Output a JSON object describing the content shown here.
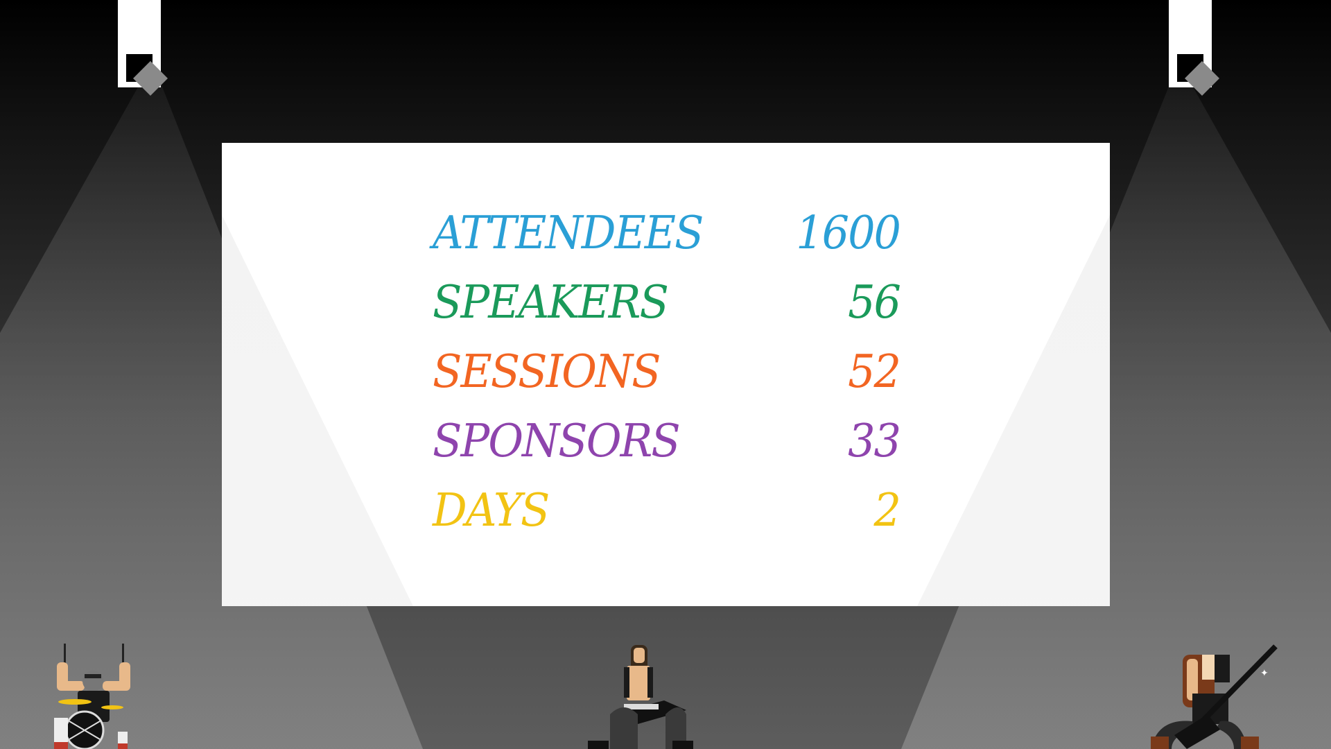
{
  "stats": [
    {
      "label": "ATTENDEES",
      "value": "1600",
      "color": "#2a9fd6"
    },
    {
      "label": "SPEAKERS",
      "value": "56",
      "color": "#1a9a5a"
    },
    {
      "label": "SESSIONS",
      "value": "52",
      "color": "#f26522"
    },
    {
      "label": "SPONSORS",
      "value": "33",
      "color": "#8e44ad"
    },
    {
      "label": "DAYS",
      "value": "2",
      "color": "#f2c313"
    }
  ],
  "icons": {
    "left_spotlight": "spotlight-icon",
    "right_spotlight": "spotlight-icon",
    "drummer": "drummer-icon",
    "singer": "singer-guitarist-icon",
    "bassist": "bassist-icon"
  },
  "colors": {
    "stage_top": "#000000",
    "stage_bottom": "#5d5d5d",
    "screen": "#ffffff",
    "light_beam": "#ffffff"
  }
}
